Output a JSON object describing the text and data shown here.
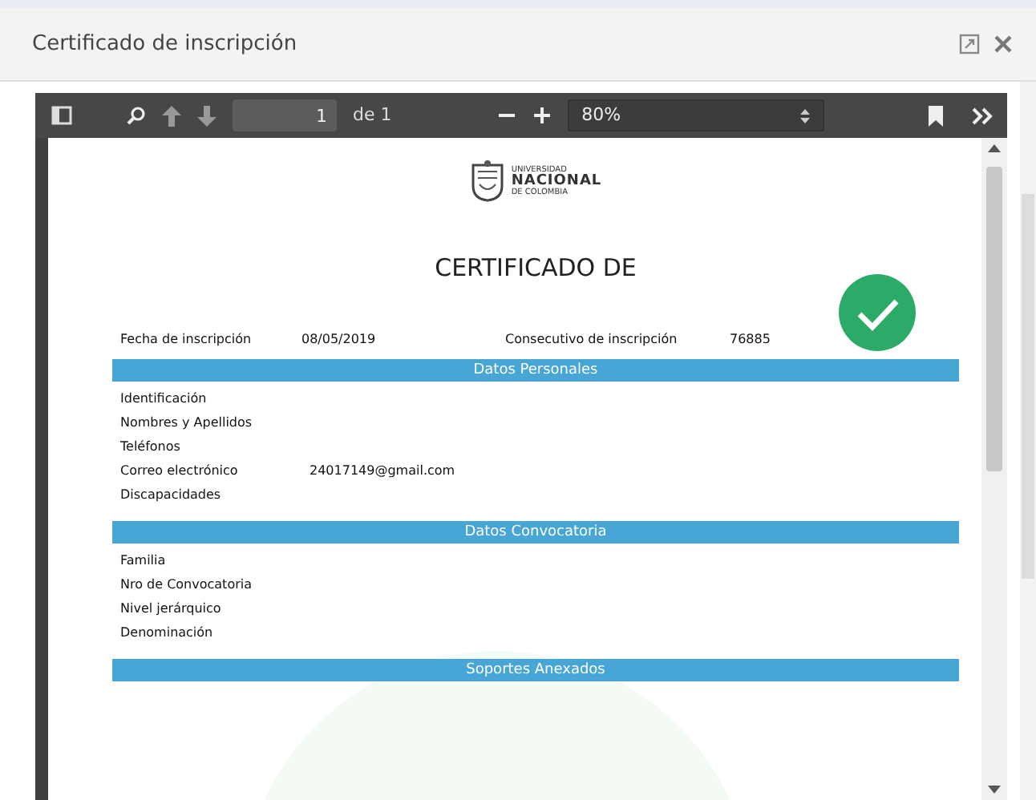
{
  "dialog": {
    "title": "Certificado de inscripción"
  },
  "toolbar": {
    "page_number": "1",
    "page_count": "de 1",
    "zoom": "80%"
  },
  "document": {
    "logo": {
      "line_1": "UNIVERSIDAD",
      "line_2": "NACIONAL",
      "line_3": "DE COLOMBIA"
    },
    "title": "CERTIFICADO DE",
    "info": [
      {
        "label": "Fecha de inscripción",
        "value": "08/05/2019"
      },
      {
        "label": "Consecutivo de inscripción",
        "value": "76885"
      }
    ],
    "sections": [
      {
        "title": "Datos Personales",
        "rows": [
          {
            "label": "Identificación"
          },
          {
            "label": "Nombres y Apellidos"
          },
          {
            "label": "Teléfonos"
          },
          {
            "label": "Correo electrónico",
            "value": "24017149@gmail.com"
          },
          {
            "label": "Discapacidades"
          }
        ]
      },
      {
        "title": "Datos Convocatoria",
        "rows": [
          {
            "label": "Familia"
          },
          {
            "label": "Nro de Convocatoria"
          },
          {
            "label": "Nivel jerárquico"
          },
          {
            "label": "Denominación"
          }
        ]
      },
      {
        "title": "Soportes Anexados"
      }
    ]
  }
}
